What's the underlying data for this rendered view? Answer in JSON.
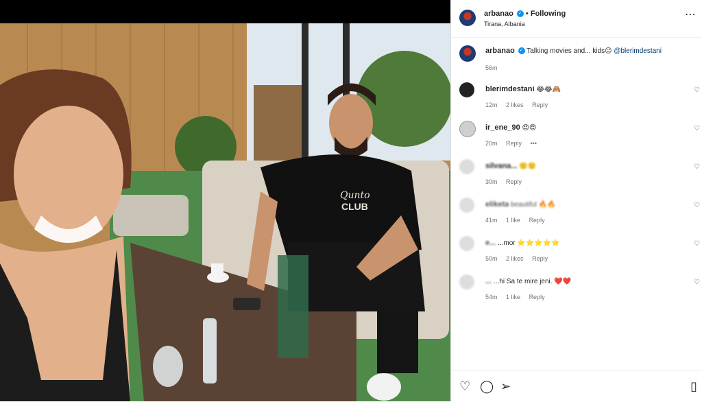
{
  "post": {
    "username": "arbanao",
    "follow_status": "Following",
    "location": "Tirana, Albania",
    "caption_text": "Talking movies and... kids😉",
    "caption_mention": "@blerimdestani",
    "caption_time": "56m",
    "print_text": "Qunto CLUB"
  },
  "comments": [
    {
      "user": "blerimdestani",
      "text": "😂😂🙈",
      "time": "12m",
      "likes": "2 likes",
      "reply": "Reply",
      "more": ""
    },
    {
      "user": "ir_ene_90",
      "text": "😍😍",
      "time": "20m",
      "likes": "",
      "reply": "Reply",
      "more": "•••"
    },
    {
      "user": "silvana...",
      "text": "🙂🙂",
      "time": "30m",
      "likes": "",
      "reply": "Reply",
      "more": ""
    },
    {
      "user": "eliketa",
      "text": "beautiful 🔥🔥",
      "time": "41m",
      "likes": "1 like",
      "reply": "Reply",
      "more": ""
    },
    {
      "user": "e...",
      "text": "...mor ⭐⭐⭐⭐⭐",
      "time": "50m",
      "likes": "2 likes",
      "reply": "Reply",
      "more": ""
    },
    {
      "user": "...",
      "text": "...hi Sa te mire jeni. ❤️❤️",
      "time": "54m",
      "likes": "1 like",
      "reply": "Reply",
      "more": ""
    }
  ],
  "icons": {
    "more": "⋯",
    "heart": "♡",
    "comment": "◯",
    "share": "➢",
    "bookmark": "▯"
  },
  "colors": {
    "verified": "#0095f6",
    "link": "#00376b",
    "muted": "#737373"
  }
}
